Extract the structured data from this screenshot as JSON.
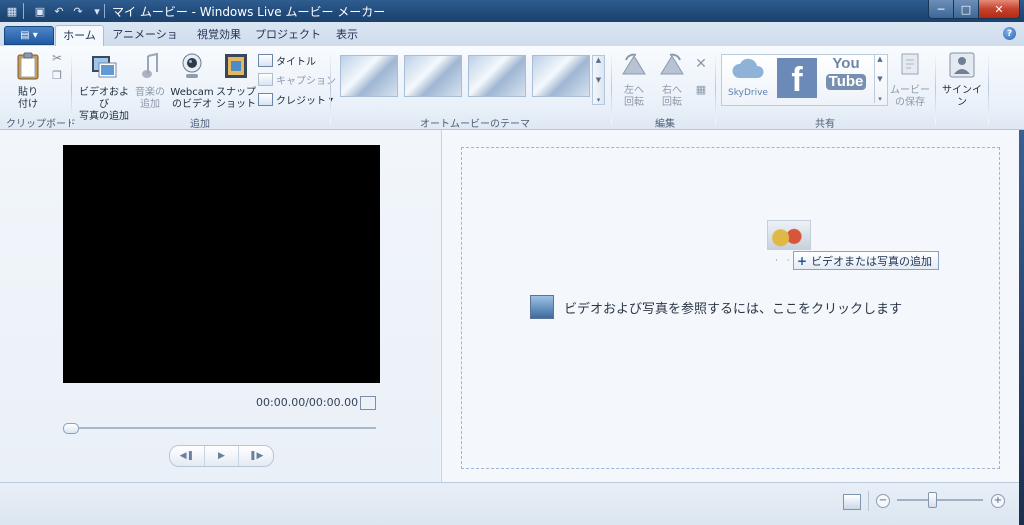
{
  "window": {
    "title": "マイ ムービー - Windows Live ムービー メーカー"
  },
  "tabs": [
    {
      "label": "ホーム",
      "active": true
    },
    {
      "label": "アニメーション",
      "active": false
    },
    {
      "label": "視覚効果",
      "active": false
    },
    {
      "label": "プロジェクト",
      "active": false
    },
    {
      "label": "表示",
      "active": false
    }
  ],
  "ribbon": {
    "clipboard": {
      "label": "クリップボード",
      "paste_line1": "貼り",
      "paste_line2": "付け"
    },
    "add": {
      "label": "追加",
      "add_video_line1": "ビデオおよび",
      "add_video_line2": "写真の追加",
      "add_music_line1": "音楽の",
      "add_music_line2": "追加",
      "webcam_line1": "Webcam",
      "webcam_line2": "のビデオ",
      "snapshot_line1": "スナップ",
      "snapshot_line2": "ショット",
      "title": "タイトル",
      "caption": "キャプション",
      "credit": "クレジット"
    },
    "automovie": {
      "label": "オートムービーのテーマ"
    },
    "edit": {
      "label": "編集",
      "rotate_left_line1": "左へ",
      "rotate_left_line2": "回転",
      "rotate_right_line1": "右へ",
      "rotate_right_line2": "回転"
    },
    "share": {
      "label": "共有",
      "skydrive": "SkyDrive",
      "facebook": "f",
      "youtube_line1": "You",
      "youtube_line2": "Tube",
      "save_movie_line1": "ムービー",
      "save_movie_line2": "の保存"
    },
    "signin": {
      "label": "サインイン"
    }
  },
  "preview": {
    "time": "00:00.00/00:00.00"
  },
  "storyboard": {
    "hint": "ビデオおよび写真を参照するには、ここをクリックします",
    "add_tooltip": "ビデオまたは写真の追加"
  }
}
